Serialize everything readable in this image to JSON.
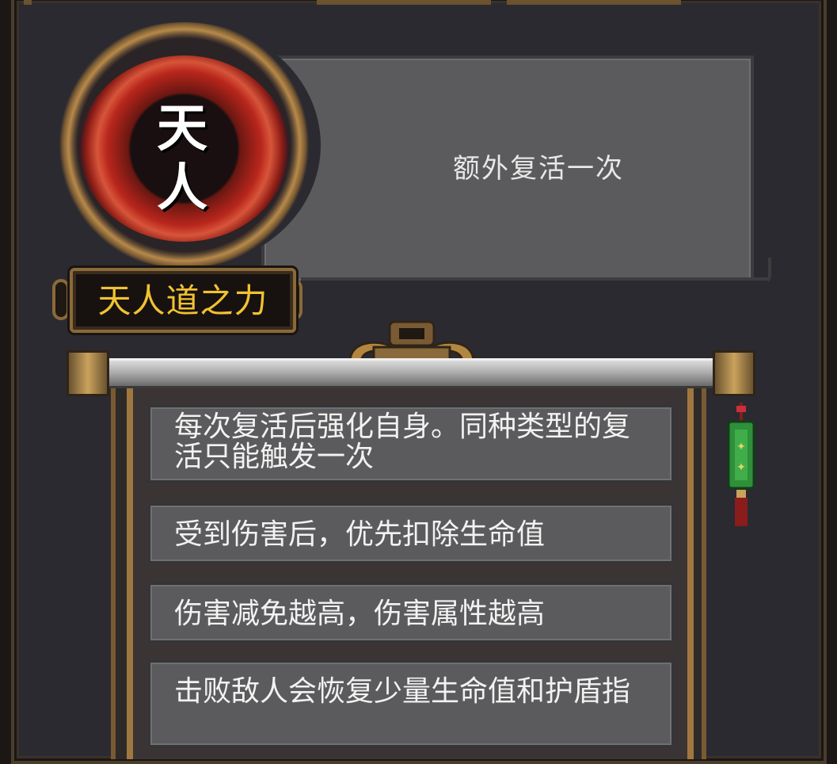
{
  "skill": {
    "seal_glyph": "天人",
    "name": "天人道之力",
    "description": "额外复活一次"
  },
  "scroll": {
    "entries": [
      {
        "text": "每次复活后强化自身。同种类型的复活只能触发一次"
      },
      {
        "text": "受到伤害后，优先扣除生命值"
      },
      {
        "text": "伤害减免越高，伤害属性越高"
      },
      {
        "text": "击败敌人会恢复少量生命值和护盾指"
      }
    ]
  },
  "colors": {
    "name_gold": "#f1c232",
    "panel_gray": "#5b5b5d",
    "frame_bg": "#2b2a30",
    "seal_red": "#b8261c",
    "tassel_green": "#2f8f3a"
  },
  "icons": {
    "seal": "tianren-seal-icon",
    "tassel": "jade-tassel-icon",
    "crest": "scroll-crest-ornament"
  }
}
